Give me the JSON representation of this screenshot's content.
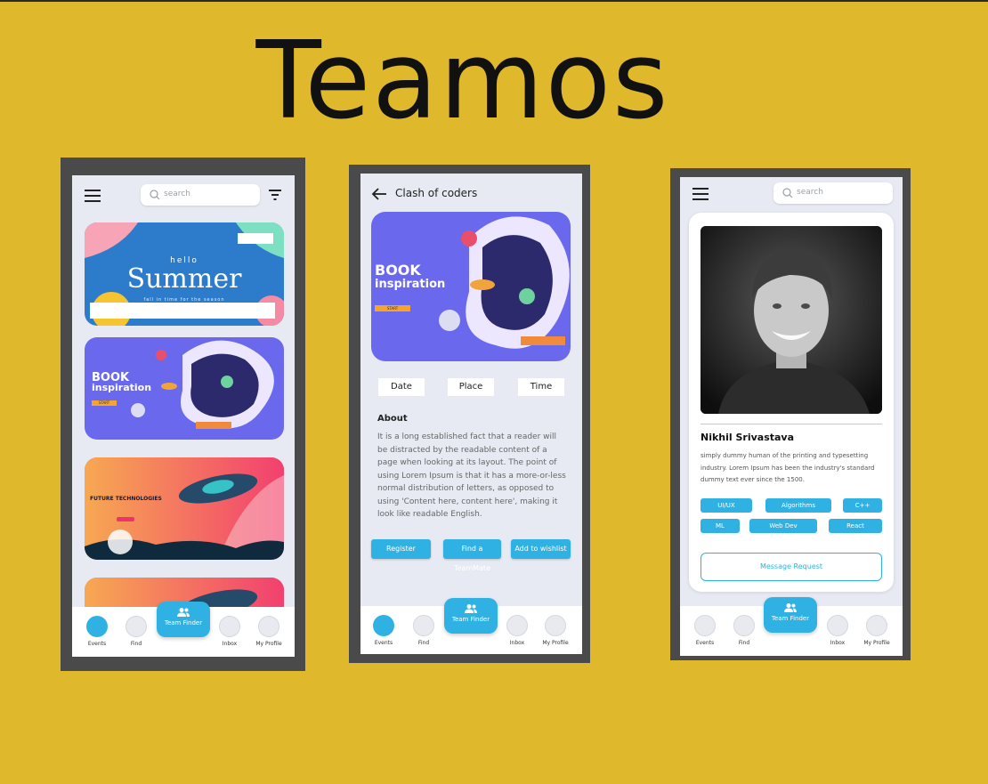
{
  "title": "Teamos",
  "search": {
    "placeholder": "search"
  },
  "nav": {
    "events": "Events",
    "find": "Find",
    "team_finder": "Team Finder",
    "inbox": "Inbox",
    "my_profile": "My Profile"
  },
  "screen1": {
    "banners": [
      {
        "top": "hello",
        "main": "Summer",
        "sub": "fall in time for the season"
      },
      {
        "line1": "BOOK",
        "line2": "inspiration",
        "cta": "START"
      },
      {
        "main": "FUTURE TECHNOLOGIES"
      }
    ]
  },
  "screen2": {
    "header": "Clash of coders",
    "banner": {
      "line1": "BOOK",
      "line2": "inspiration",
      "cta": "START"
    },
    "pills": [
      "Date",
      "Place",
      "Time"
    ],
    "about_heading": "About",
    "about_text": "It is a long established fact that a reader will be distracted by the readable content of a page when looking at its layout. The point of using Lorem Ipsum is that it has a more-or-less normal distribution of letters, as opposed to using 'Content here, content here', making it look like readable English.",
    "buttons": [
      "Register",
      "Find a TeamMate",
      "Add to wishlist"
    ]
  },
  "screen3": {
    "name": "Nikhil Srivastava",
    "bio": "simply dummy human of the printing and typesetting industry. Lorem Ipsum has been the industry's standard dummy text ever since the 1500.",
    "tags": [
      "UI/UX",
      "Algorithms",
      "C++",
      "ML",
      "Web Dev",
      "React"
    ],
    "message_button": "Message Request"
  },
  "colors": {
    "background": "#dfb82b",
    "accent": "#2fb2e3",
    "frame": "#4a4a4a",
    "screen": "#e7eaf2"
  }
}
